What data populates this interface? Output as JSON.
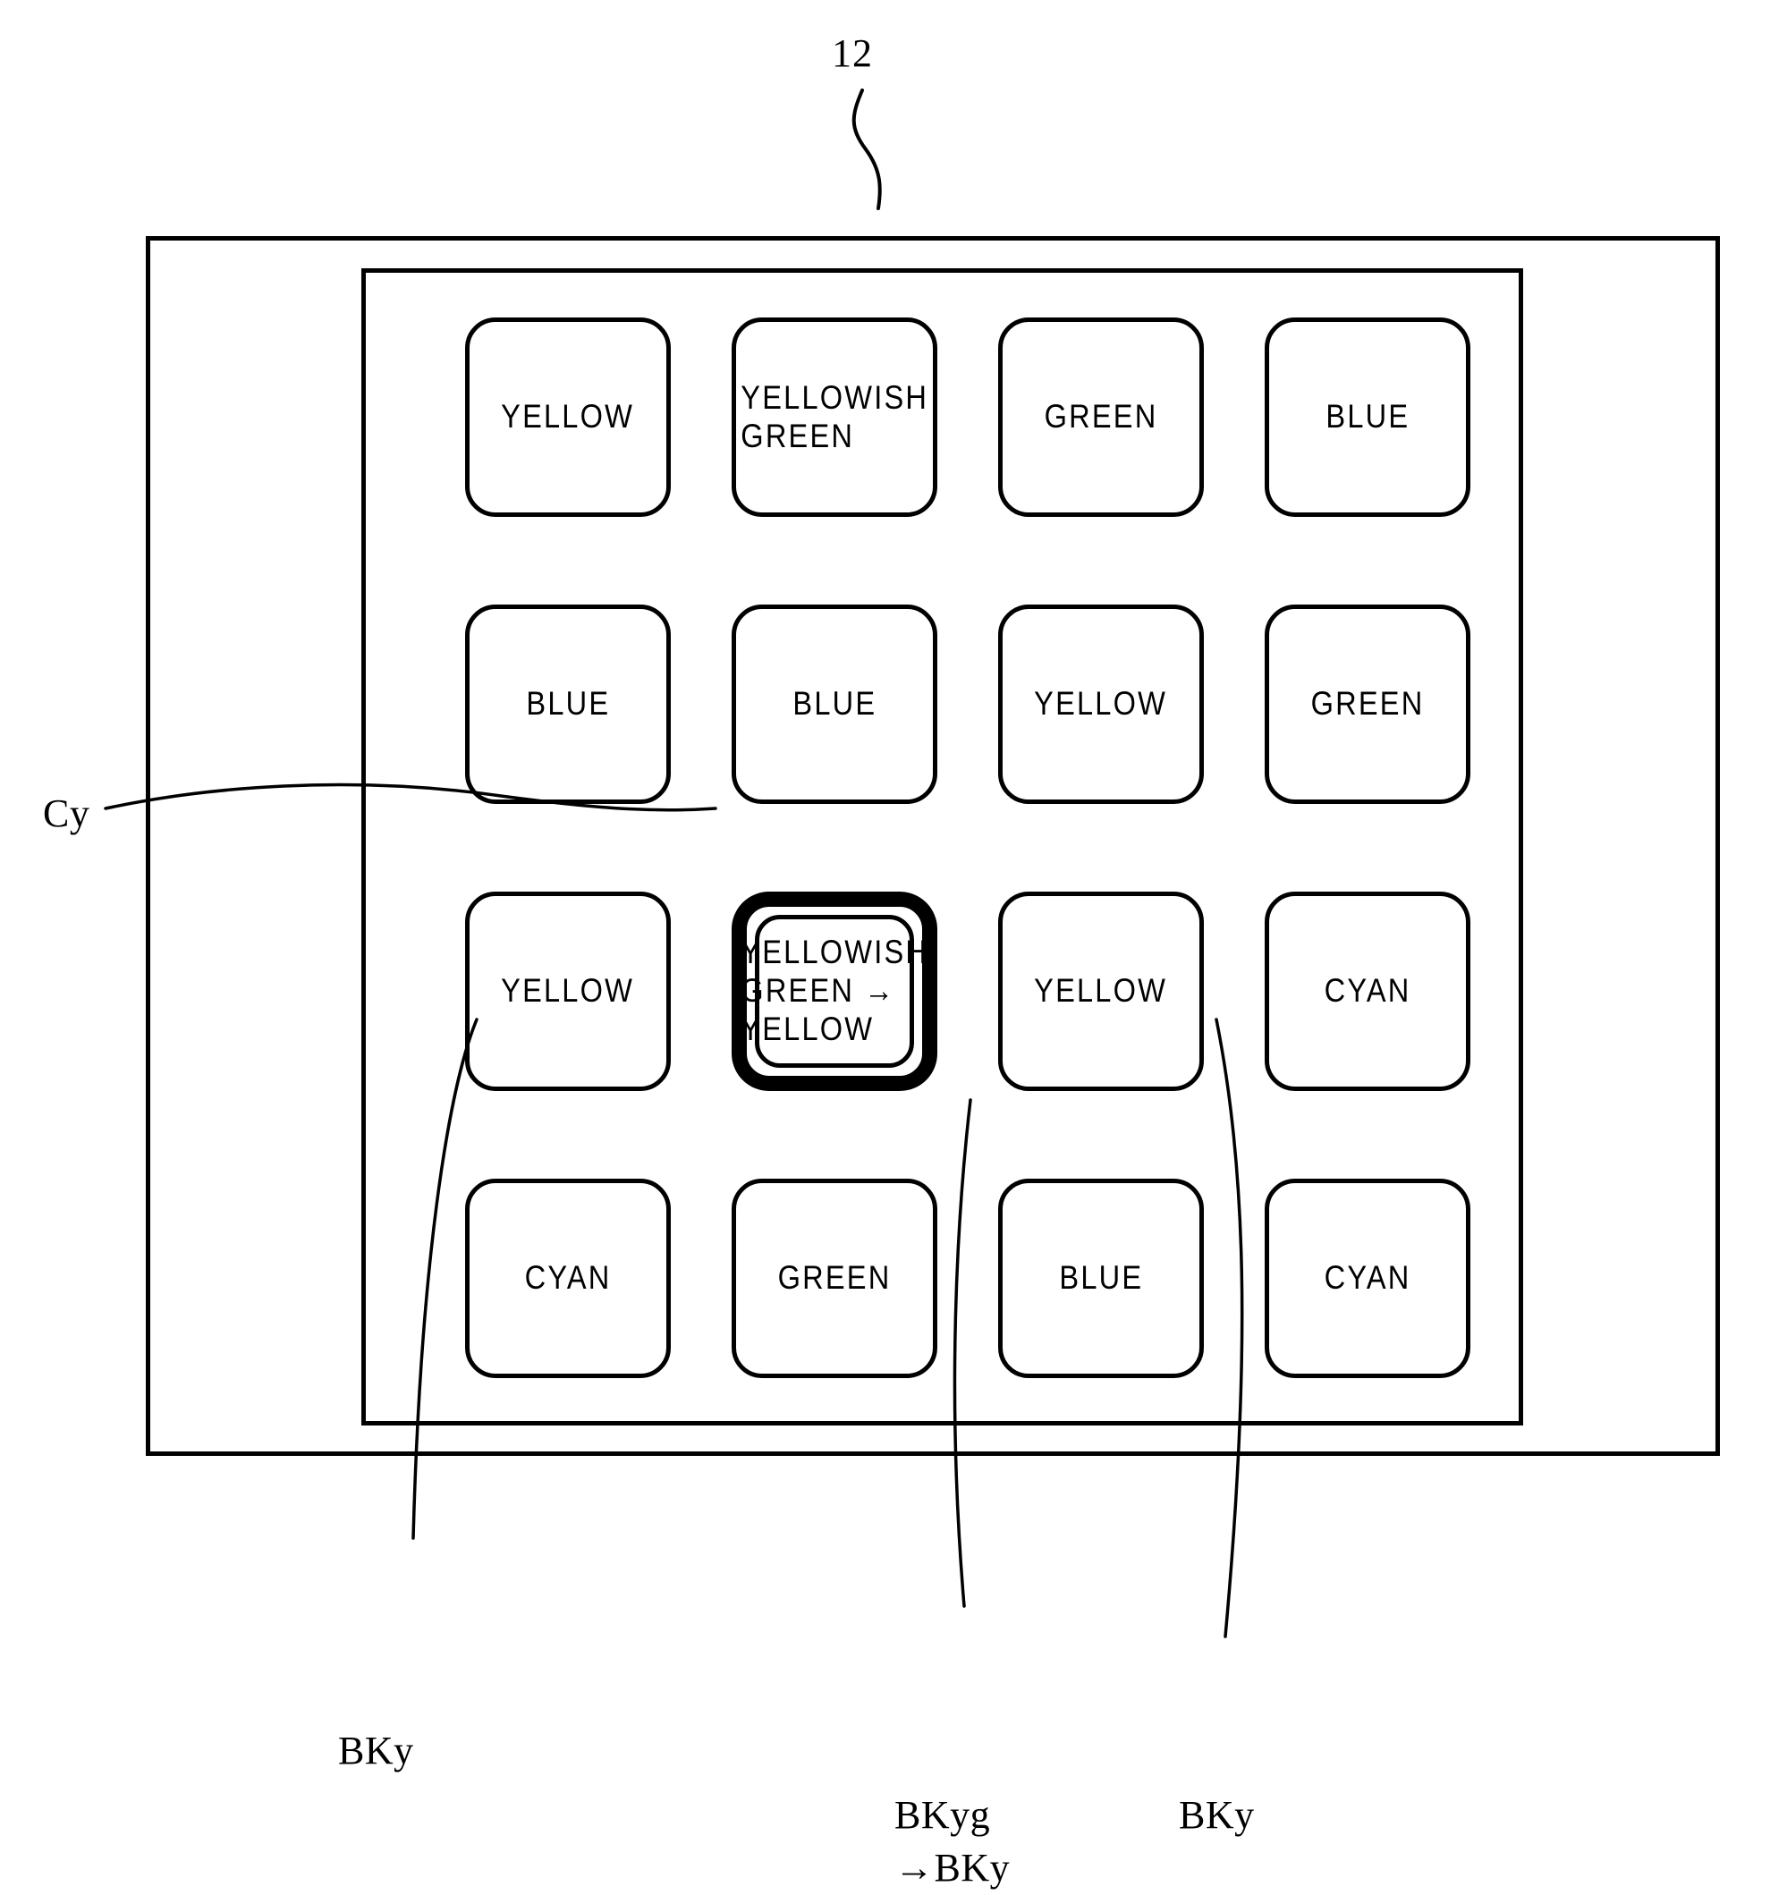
{
  "figure": {
    "reference_numeral": "12",
    "keys": [
      [
        {
          "label": "YELLOW",
          "align": "center",
          "highlighted": false
        },
        {
          "label": "YELLOWISH\nGREEN",
          "align": "left",
          "highlighted": false
        },
        {
          "label": "GREEN",
          "align": "center",
          "highlighted": false
        },
        {
          "label": "BLUE",
          "align": "center",
          "highlighted": false
        }
      ],
      [
        {
          "label": "BLUE",
          "align": "center",
          "highlighted": false
        },
        {
          "label": "BLUE",
          "align": "center",
          "highlighted": false
        },
        {
          "label": "YELLOW",
          "align": "center",
          "highlighted": false
        },
        {
          "label": "GREEN",
          "align": "center",
          "highlighted": false
        }
      ],
      [
        {
          "label": "YELLOW",
          "align": "center",
          "highlighted": false
        },
        {
          "label": "YELLOWISH\nGREEN →\nYELLOW",
          "align": "left",
          "highlighted": true
        },
        {
          "label": "YELLOW",
          "align": "center",
          "highlighted": false
        },
        {
          "label": "CYAN",
          "align": "center",
          "highlighted": false
        }
      ],
      [
        {
          "label": "CYAN",
          "align": "center",
          "highlighted": false
        },
        {
          "label": "GREEN",
          "align": "center",
          "highlighted": false
        },
        {
          "label": "BLUE",
          "align": "center",
          "highlighted": false
        },
        {
          "label": "CYAN",
          "align": "center",
          "highlighted": false
        }
      ]
    ],
    "callouts": {
      "cy": "Cy",
      "bky_left": "BKy",
      "bkyg": "BKyg\n→BKy",
      "bky_right": "BKy"
    },
    "colors": {
      "ink": "#000000",
      "paper": "#ffffff"
    }
  }
}
